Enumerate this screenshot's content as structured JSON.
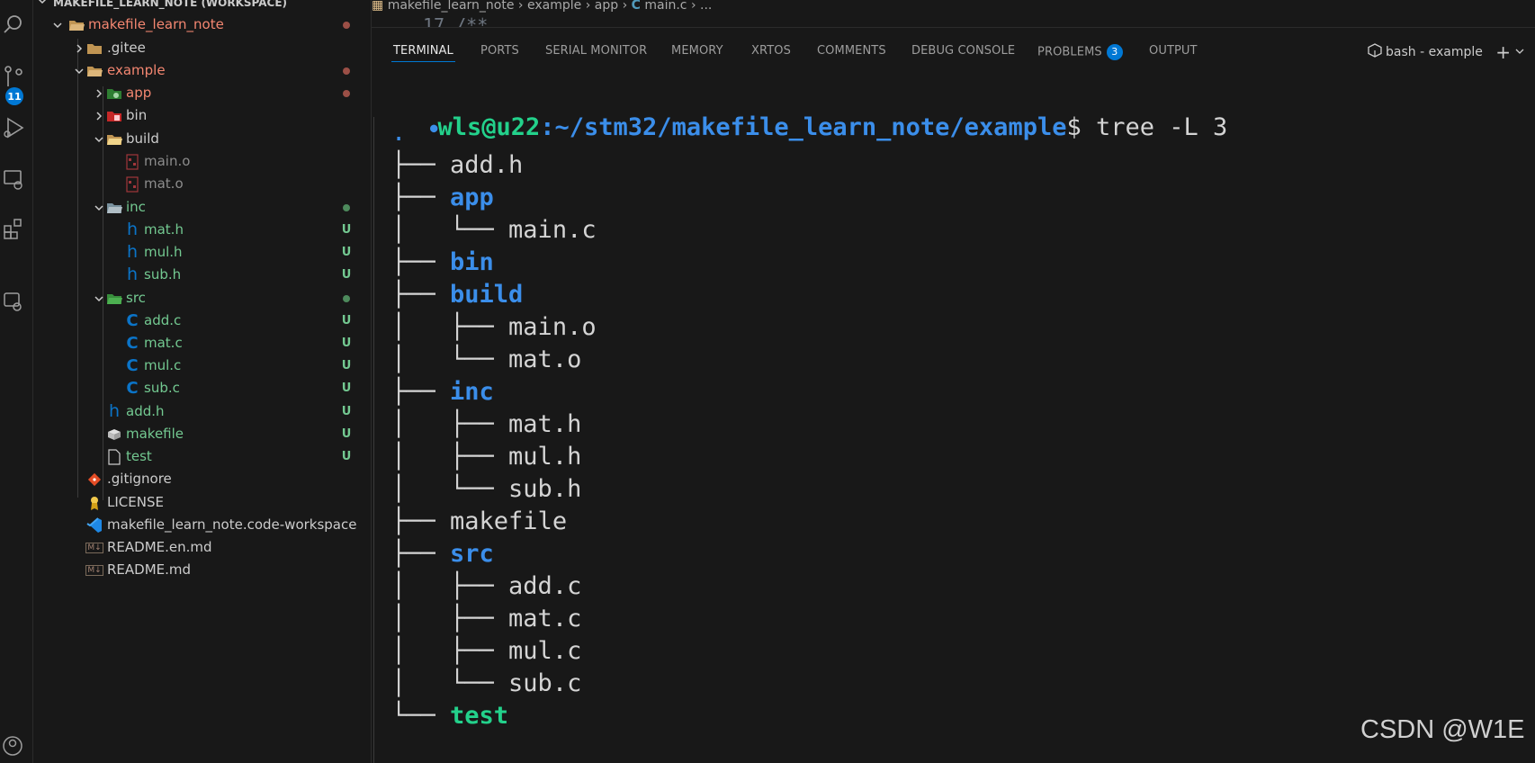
{
  "explorer": {
    "header": "MAKEFILE_LEARN_NOTE (WORKSPACE)",
    "items": [
      {
        "label": "makefile_learn_note",
        "status": "dot",
        "color": "#f48771"
      },
      {
        "label": ".gitee",
        "status": "",
        "color": "#cccccc"
      },
      {
        "label": "example",
        "status": "dot",
        "color": "#f48771"
      },
      {
        "label": "app",
        "status": "dot",
        "color": "#f48771"
      },
      {
        "label": "bin",
        "status": "",
        "color": "#cccccc"
      },
      {
        "label": "build",
        "status": "",
        "color": "#cccccc"
      },
      {
        "label": "main.o",
        "status": "",
        "color": "#8c8c8c"
      },
      {
        "label": "mat.o",
        "status": "",
        "color": "#8c8c8c"
      },
      {
        "label": "inc",
        "status": "dot",
        "color": "#73c991"
      },
      {
        "label": "mat.h",
        "status": "U",
        "color": "#73c991"
      },
      {
        "label": "mul.h",
        "status": "U",
        "color": "#73c991"
      },
      {
        "label": "sub.h",
        "status": "U",
        "color": "#73c991"
      },
      {
        "label": "src",
        "status": "dot",
        "color": "#73c991"
      },
      {
        "label": "add.c",
        "status": "U",
        "color": "#73c991"
      },
      {
        "label": "mat.c",
        "status": "U",
        "color": "#73c991"
      },
      {
        "label": "mul.c",
        "status": "U",
        "color": "#73c991"
      },
      {
        "label": "sub.c",
        "status": "U",
        "color": "#73c991"
      },
      {
        "label": "add.h",
        "status": "U",
        "color": "#73c991"
      },
      {
        "label": "makefile",
        "status": "U",
        "color": "#73c991"
      },
      {
        "label": "test",
        "status": "U",
        "color": "#73c991"
      },
      {
        "label": ".gitignore",
        "status": "",
        "color": "#cccccc"
      },
      {
        "label": "LICENSE",
        "status": "",
        "color": "#cccccc"
      },
      {
        "label": "makefile_learn_note.code-workspace",
        "status": "",
        "color": "#cccccc"
      },
      {
        "label": "README.en.md",
        "status": "",
        "color": "#cccccc"
      },
      {
        "label": "README.md",
        "status": "",
        "color": "#cccccc"
      }
    ]
  },
  "activity": {
    "scm_badge": "11"
  },
  "breadcrumb": {
    "parts": [
      "makefile_learn_note",
      "example",
      "app",
      "main.c",
      "..."
    ],
    "code_line": "17    /**"
  },
  "panel": {
    "tabs": [
      "TERMINAL",
      "PORTS",
      "SERIAL MONITOR",
      "MEMORY",
      "XRTOS",
      "COMMENTS",
      "DEBUG CONSOLE",
      "PROBLEMS",
      "OUTPUT"
    ],
    "problems_count": "3",
    "terminal_title": "bash - example"
  },
  "terminal": {
    "prompt_user": "wls@u22",
    "prompt_path": ":~/stm32/makefile_learn_note/example",
    "prompt_symbol": "$ ",
    "command": "tree -L 3",
    "lines": [
      {
        "prefix": ".",
        "name": "",
        "kind": "dir"
      },
      {
        "prefix": "├── ",
        "name": "add.h",
        "kind": "file"
      },
      {
        "prefix": "├── ",
        "name": "app",
        "kind": "dir"
      },
      {
        "prefix": "│   └── ",
        "name": "main.c",
        "kind": "file"
      },
      {
        "prefix": "├── ",
        "name": "bin",
        "kind": "dir"
      },
      {
        "prefix": "├── ",
        "name": "build",
        "kind": "dir"
      },
      {
        "prefix": "│   ├── ",
        "name": "main.o",
        "kind": "file"
      },
      {
        "prefix": "│   └── ",
        "name": "mat.o",
        "kind": "file"
      },
      {
        "prefix": "├── ",
        "name": "inc",
        "kind": "dir"
      },
      {
        "prefix": "│   ├── ",
        "name": "mat.h",
        "kind": "file"
      },
      {
        "prefix": "│   ├── ",
        "name": "mul.h",
        "kind": "file"
      },
      {
        "prefix": "│   └── ",
        "name": "sub.h",
        "kind": "file"
      },
      {
        "prefix": "├── ",
        "name": "makefile",
        "kind": "file"
      },
      {
        "prefix": "├── ",
        "name": "src",
        "kind": "dir"
      },
      {
        "prefix": "│   ├── ",
        "name": "add.c",
        "kind": "file"
      },
      {
        "prefix": "│   ├── ",
        "name": "mat.c",
        "kind": "file"
      },
      {
        "prefix": "│   ├── ",
        "name": "mul.c",
        "kind": "file"
      },
      {
        "prefix": "│   └── ",
        "name": "sub.c",
        "kind": "file"
      },
      {
        "prefix": "└── ",
        "name": "test",
        "kind": "exe"
      }
    ]
  },
  "watermark": "CSDN @W1E"
}
